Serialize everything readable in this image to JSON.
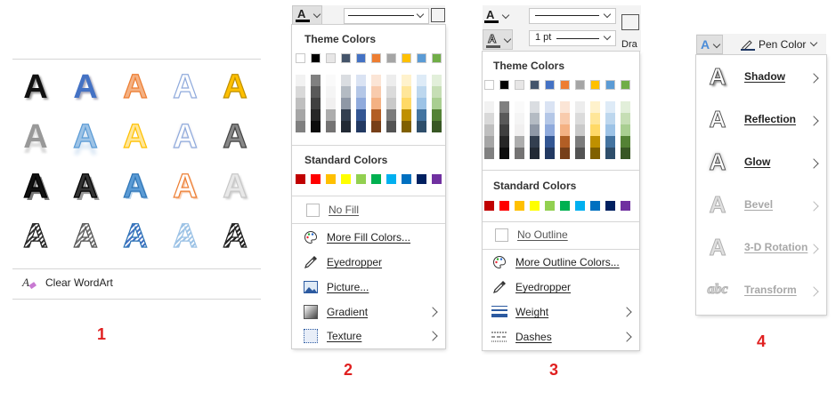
{
  "panel1": {
    "clear_label": "Clear WordArt",
    "number": "1",
    "glyph": "A"
  },
  "panel2": {
    "theme_title": "Theme Colors",
    "standard_title": "Standard Colors",
    "no_fill": "No Fill",
    "items": [
      "More Fill Colors...",
      "Eyedropper",
      "Picture...",
      "Gradient",
      "Texture"
    ],
    "toolbar_button": "A",
    "toolbar_extra": "",
    "number": "2"
  },
  "panel3": {
    "theme_title": "Theme Colors",
    "standard_title": "Standard Colors",
    "no_outline": "No Outline",
    "items": [
      "More Outline Colors...",
      "Eyedropper",
      "Weight",
      "Dashes"
    ],
    "weight_value": "1 pt",
    "draw_label": "Dra",
    "number": "3"
  },
  "panel4": {
    "pen_color": "Pen Color",
    "items": [
      "Shadow",
      "Reflection",
      "Glow",
      "Bevel",
      "3-D Rotation",
      "Transform"
    ],
    "transform_glyph": "abc",
    "number": "4"
  },
  "colors": {
    "theme_top": [
      "#ffffff",
      "#000000",
      "#e7e6e6",
      "#44546a",
      "#4472c4",
      "#ed7d31",
      "#a5a5a5",
      "#ffc000",
      "#5b9bd5",
      "#70ad47"
    ],
    "standard": [
      "#c00000",
      "#ff0000",
      "#ffc000",
      "#ffff00",
      "#92d050",
      "#00b050",
      "#00b0f0",
      "#0070c0",
      "#002060",
      "#7030a0"
    ],
    "accent_number": "#e02020"
  }
}
